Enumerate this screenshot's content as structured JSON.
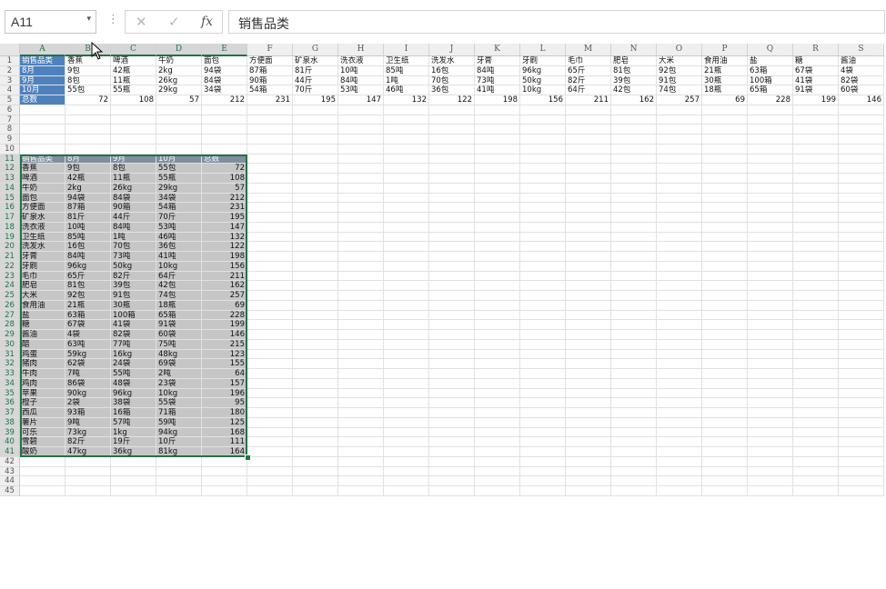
{
  "formula_bar": {
    "name_box": "A11",
    "name_box_arrow": "▾",
    "dots": "⋮",
    "cancel_icon": "✕",
    "enter_icon": "✓",
    "fx_icon": "fx",
    "content": "销售品类"
  },
  "columns": [
    "A",
    "B",
    "C",
    "D",
    "E",
    "F",
    "G",
    "H",
    "I",
    "J",
    "K",
    "L",
    "M",
    "N",
    "O",
    "P",
    "Q",
    "R",
    "S"
  ],
  "rows": [
    "1",
    "2",
    "3",
    "4",
    "5",
    "6",
    "7",
    "8",
    "9",
    "10",
    "11",
    "12",
    "13",
    "14",
    "15",
    "16",
    "17",
    "18",
    "19",
    "20",
    "21",
    "22",
    "23",
    "24",
    "25",
    "26",
    "27",
    "28",
    "29",
    "30",
    "31",
    "32",
    "33",
    "34",
    "35",
    "36",
    "37",
    "38",
    "39",
    "40",
    "41",
    "42",
    "43",
    "44",
    "45"
  ],
  "top_table": [
    [
      "销售品类",
      "香蕉",
      "啤酒",
      "牛奶",
      "面包",
      "方便面",
      "矿泉水",
      "洗衣液",
      "卫生纸",
      "洗发水",
      "牙膏",
      "牙刷",
      "毛巾",
      "肥皂",
      "大米",
      "食用油",
      "盐",
      "糖",
      "酱油"
    ],
    [
      "8月",
      "9包",
      "42瓶",
      "2kg",
      "94袋",
      "87箱",
      "81斤",
      "10吨",
      "85吨",
      "16包",
      "84吨",
      "96kg",
      "65斤",
      "81包",
      "92包",
      "21瓶",
      "63箱",
      "67袋",
      "4袋"
    ],
    [
      "9月",
      "8包",
      "11瓶",
      "26kg",
      "84袋",
      "90箱",
      "44斤",
      "84吨",
      "1吨",
      "70包",
      "73吨",
      "50kg",
      "82斤",
      "39包",
      "91包",
      "30瓶",
      "100箱",
      "41袋",
      "82袋"
    ],
    [
      "10月",
      "55包",
      "55瓶",
      "29kg",
      "34袋",
      "54箱",
      "70斤",
      "53吨",
      "46吨",
      "36包",
      "41吨",
      "10kg",
      "64斤",
      "42包",
      "74包",
      "18瓶",
      "65箱",
      "91袋",
      "60袋"
    ],
    [
      "总数",
      "72",
      "108",
      "57",
      "212",
      "231",
      "195",
      "147",
      "132",
      "122",
      "198",
      "156",
      "211",
      "162",
      "257",
      "69",
      "228",
      "199",
      "146"
    ]
  ],
  "bottom_header": [
    "销售品类",
    "8月",
    "9月",
    "10月",
    "总数"
  ],
  "bottom_table": [
    [
      "香蕉",
      "9包",
      "8包",
      "55包",
      "72"
    ],
    [
      "啤酒",
      "42瓶",
      "11瓶",
      "55瓶",
      "108"
    ],
    [
      "牛奶",
      "2kg",
      "26kg",
      "29kg",
      "57"
    ],
    [
      "面包",
      "94袋",
      "84袋",
      "34袋",
      "212"
    ],
    [
      "方便面",
      "87箱",
      "90箱",
      "54箱",
      "231"
    ],
    [
      "矿泉水",
      "81斤",
      "44斤",
      "70斤",
      "195"
    ],
    [
      "洗衣液",
      "10吨",
      "84吨",
      "53吨",
      "147"
    ],
    [
      "卫生纸",
      "85吨",
      "1吨",
      "46吨",
      "132"
    ],
    [
      "洗发水",
      "16包",
      "70包",
      "36包",
      "122"
    ],
    [
      "牙膏",
      "84吨",
      "73吨",
      "41吨",
      "198"
    ],
    [
      "牙刷",
      "96kg",
      "50kg",
      "10kg",
      "156"
    ],
    [
      "毛巾",
      "65斤",
      "82斤",
      "64斤",
      "211"
    ],
    [
      "肥皂",
      "81包",
      "39包",
      "42包",
      "162"
    ],
    [
      "大米",
      "92包",
      "91包",
      "74包",
      "257"
    ],
    [
      "食用油",
      "21瓶",
      "30瓶",
      "18瓶",
      "69"
    ],
    [
      "盐",
      "63箱",
      "100箱",
      "65箱",
      "228"
    ],
    [
      "糖",
      "67袋",
      "41袋",
      "91袋",
      "199"
    ],
    [
      "酱油",
      "4袋",
      "82袋",
      "60袋",
      "146"
    ],
    [
      "醋",
      "63吨",
      "77吨",
      "75吨",
      "215"
    ],
    [
      "鸡蛋",
      "59kg",
      "16kg",
      "48kg",
      "123"
    ],
    [
      "猪肉",
      "62袋",
      "24袋",
      "69袋",
      "155"
    ],
    [
      "牛肉",
      "7吨",
      "55吨",
      "2吨",
      "64"
    ],
    [
      "鸡肉",
      "86袋",
      "48袋",
      "23袋",
      "157"
    ],
    [
      "苹果",
      "90kg",
      "96kg",
      "10kg",
      "196"
    ],
    [
      "橙子",
      "2袋",
      "38袋",
      "55袋",
      "95"
    ],
    [
      "西瓜",
      "93箱",
      "16箱",
      "71箱",
      "180"
    ],
    [
      "薯片",
      "9吨",
      "57吨",
      "59吨",
      "125"
    ],
    [
      "可乐",
      "73kg",
      "1kg",
      "94kg",
      "168"
    ],
    [
      "雪碧",
      "82斤",
      "19斤",
      "10斤",
      "111"
    ],
    [
      "酸奶",
      "47kg",
      "36kg",
      "81kg",
      "164"
    ]
  ],
  "colors": {
    "accent_green": "#217346",
    "header_blue": "#4f81bd",
    "selection_gray": "#c6c6c6"
  }
}
